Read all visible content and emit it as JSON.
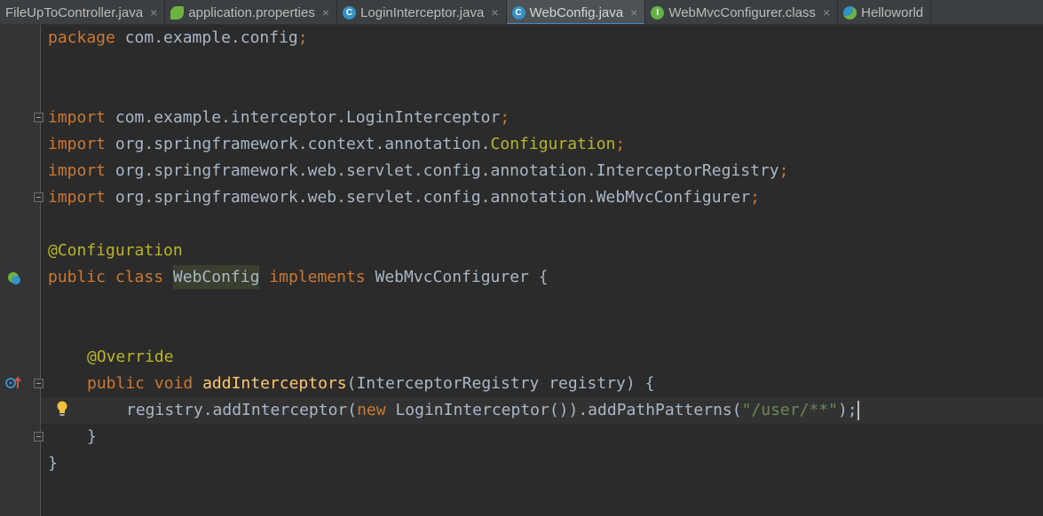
{
  "tabs": [
    {
      "label": "FileUpToController.java",
      "icon": "none",
      "active": false
    },
    {
      "label": "application.properties",
      "icon": "spring-leaf-icon",
      "active": false
    },
    {
      "label": "LoginInterceptor.java",
      "icon": "class-icon",
      "active": false
    },
    {
      "label": "WebConfig.java",
      "icon": "class-icon",
      "active": true
    },
    {
      "label": "WebMvcConfigurer.class",
      "icon": "interface-icon",
      "active": false
    },
    {
      "label": "Helloworld",
      "icon": "spring-boot-class-icon",
      "active": false
    }
  ],
  "tab_icon_letters": {
    "class": "C",
    "interface": "I"
  },
  "close_glyph": "×",
  "code": {
    "package_kw": "package",
    "package_name": " com.example.config",
    "semicolon": ";",
    "import_kw": "import",
    "import1": " com.example.interceptor.LoginInterceptor",
    "import2_prefix": " org.springframework.context.annotation.",
    "import2_highlight": "Configuration",
    "import3": " org.springframework.web.servlet.config.annotation.InterceptorRegistry",
    "import4": " org.springframework.web.servlet.config.annotation.WebMvcConfigurer",
    "class_annotation": "@Configuration",
    "public_kw": "public",
    "class_kw": " class ",
    "class_name": "WebConfig",
    "implements_kw": " implements",
    "interface_name": " WebMvcConfigurer {",
    "override_annotation": "@Override",
    "void_kw": " void ",
    "method_name": "addInterceptors",
    "method_params": "(InterceptorRegistry registry) {",
    "body_prefix": "registry.addInterceptor(",
    "new_kw": "new",
    "body_middle": " LoginInterceptor()).addPathPatterns(",
    "body_string": "\"/user/**\"",
    "body_end": ");",
    "close_method": "}",
    "close_class": "}"
  },
  "colors": {
    "keyword": "#cc7832",
    "annotation": "#bbb529",
    "string": "#6a8759",
    "method": "#ffc66d",
    "text": "#a9b7c6",
    "background": "#2b2b2b"
  }
}
